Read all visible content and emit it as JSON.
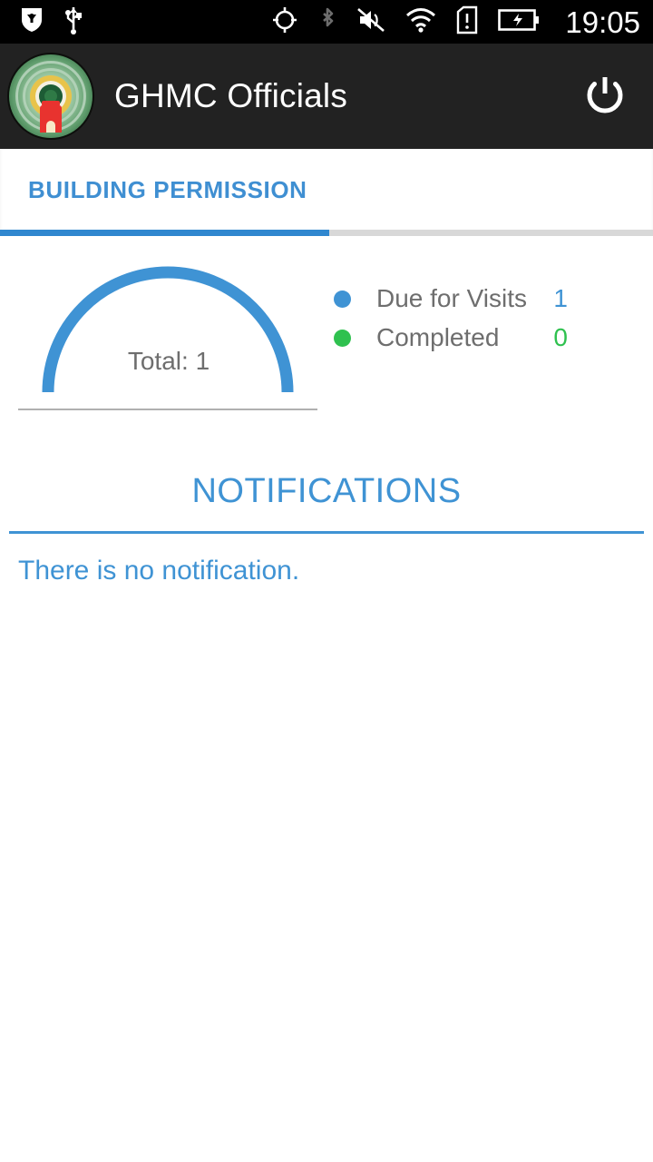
{
  "statusbar": {
    "left_icons": [
      "shield-icon",
      "usb-icon"
    ],
    "right_icons": [
      "gps-location-icon",
      "bluetooth-icon",
      "volume-mute-icon",
      "wifi-icon",
      "sim-alert-icon",
      "battery-charging-icon"
    ],
    "time": "19:05"
  },
  "appbar": {
    "logo_name": "ghmc-emblem-logo",
    "title": "GHMC Officials",
    "power_icon": "power-icon"
  },
  "tabs": [
    {
      "label": "BUILDING PERMISSION",
      "selected": true
    }
  ],
  "chart_data": {
    "type": "pie",
    "title": "",
    "subtitle": "Total: 1",
    "total_label": "Total: 1",
    "total": 1,
    "categories": [
      "Due for Visits",
      "Completed"
    ],
    "values": [
      1,
      0
    ],
    "colors": [
      "#3f93d4",
      "#2fc14f"
    ],
    "legend_position": "right",
    "shape": "half-donut",
    "arc_start_deg": 180,
    "arc_end_deg": 360,
    "grid": false
  },
  "legend": [
    {
      "label": "Due for Visits",
      "value": "1",
      "color": "#3f93d4",
      "dot": "legend-dot-blue"
    },
    {
      "label": "Completed",
      "value": "0",
      "color": "#2fc14f",
      "dot": "legend-dot-green"
    }
  ],
  "notifications": {
    "heading": "NOTIFICATIONS",
    "empty_message": "There is no notification."
  },
  "theme": {
    "accent_blue": "#3f93d4",
    "tab_indicator": "#3087cf",
    "green": "#2fc14f",
    "appbar_bg": "#222222",
    "statusbar_bg": "#000000",
    "muted_text": "#6e6e6e"
  }
}
